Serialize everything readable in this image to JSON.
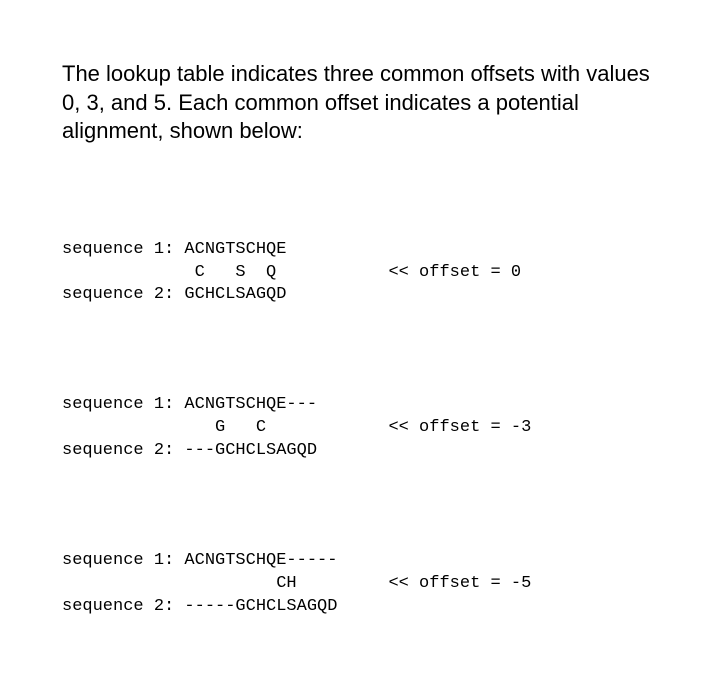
{
  "intro_text": "The lookup table indicates three common offsets with values 0, 3, and 5. Each common offset indicates a potential alignment, shown below:",
  "blocks": [
    {
      "l1": "sequence 1: ACNGTSCHQE",
      "l2": "             C   S  Q           << offset = 0",
      "l3": "sequence 2: GCHCLSAGQD"
    },
    {
      "l1": "sequence 1: ACNGTSCHQE---",
      "l2": "               G   C            << offset = -3",
      "l3": "sequence 2: ---GCHCLSAGQD"
    },
    {
      "l1": "sequence 1: ACNGTSCHQE-----",
      "l2": "                     CH         << offset = -5",
      "l3": "sequence 2: -----GCHCLSAGQD"
    }
  ]
}
